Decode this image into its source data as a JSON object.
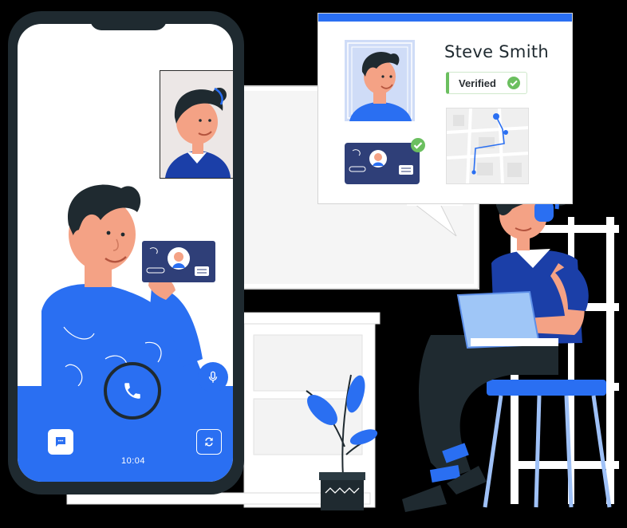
{
  "call": {
    "timer": "10:04"
  },
  "verification": {
    "name": "Steve Smith",
    "status": "Verified"
  },
  "icons": {
    "call": "phone-icon",
    "mic": "microphone-icon",
    "chat": "chat-icon",
    "flip": "switch-camera-icon",
    "check": "checkmark-icon",
    "map": "map-route-icon"
  },
  "colors": {
    "accent": "#2a6ff2",
    "dark": "#1f2a30",
    "success": "#6bbf5f",
    "card": "#2f3f78"
  }
}
